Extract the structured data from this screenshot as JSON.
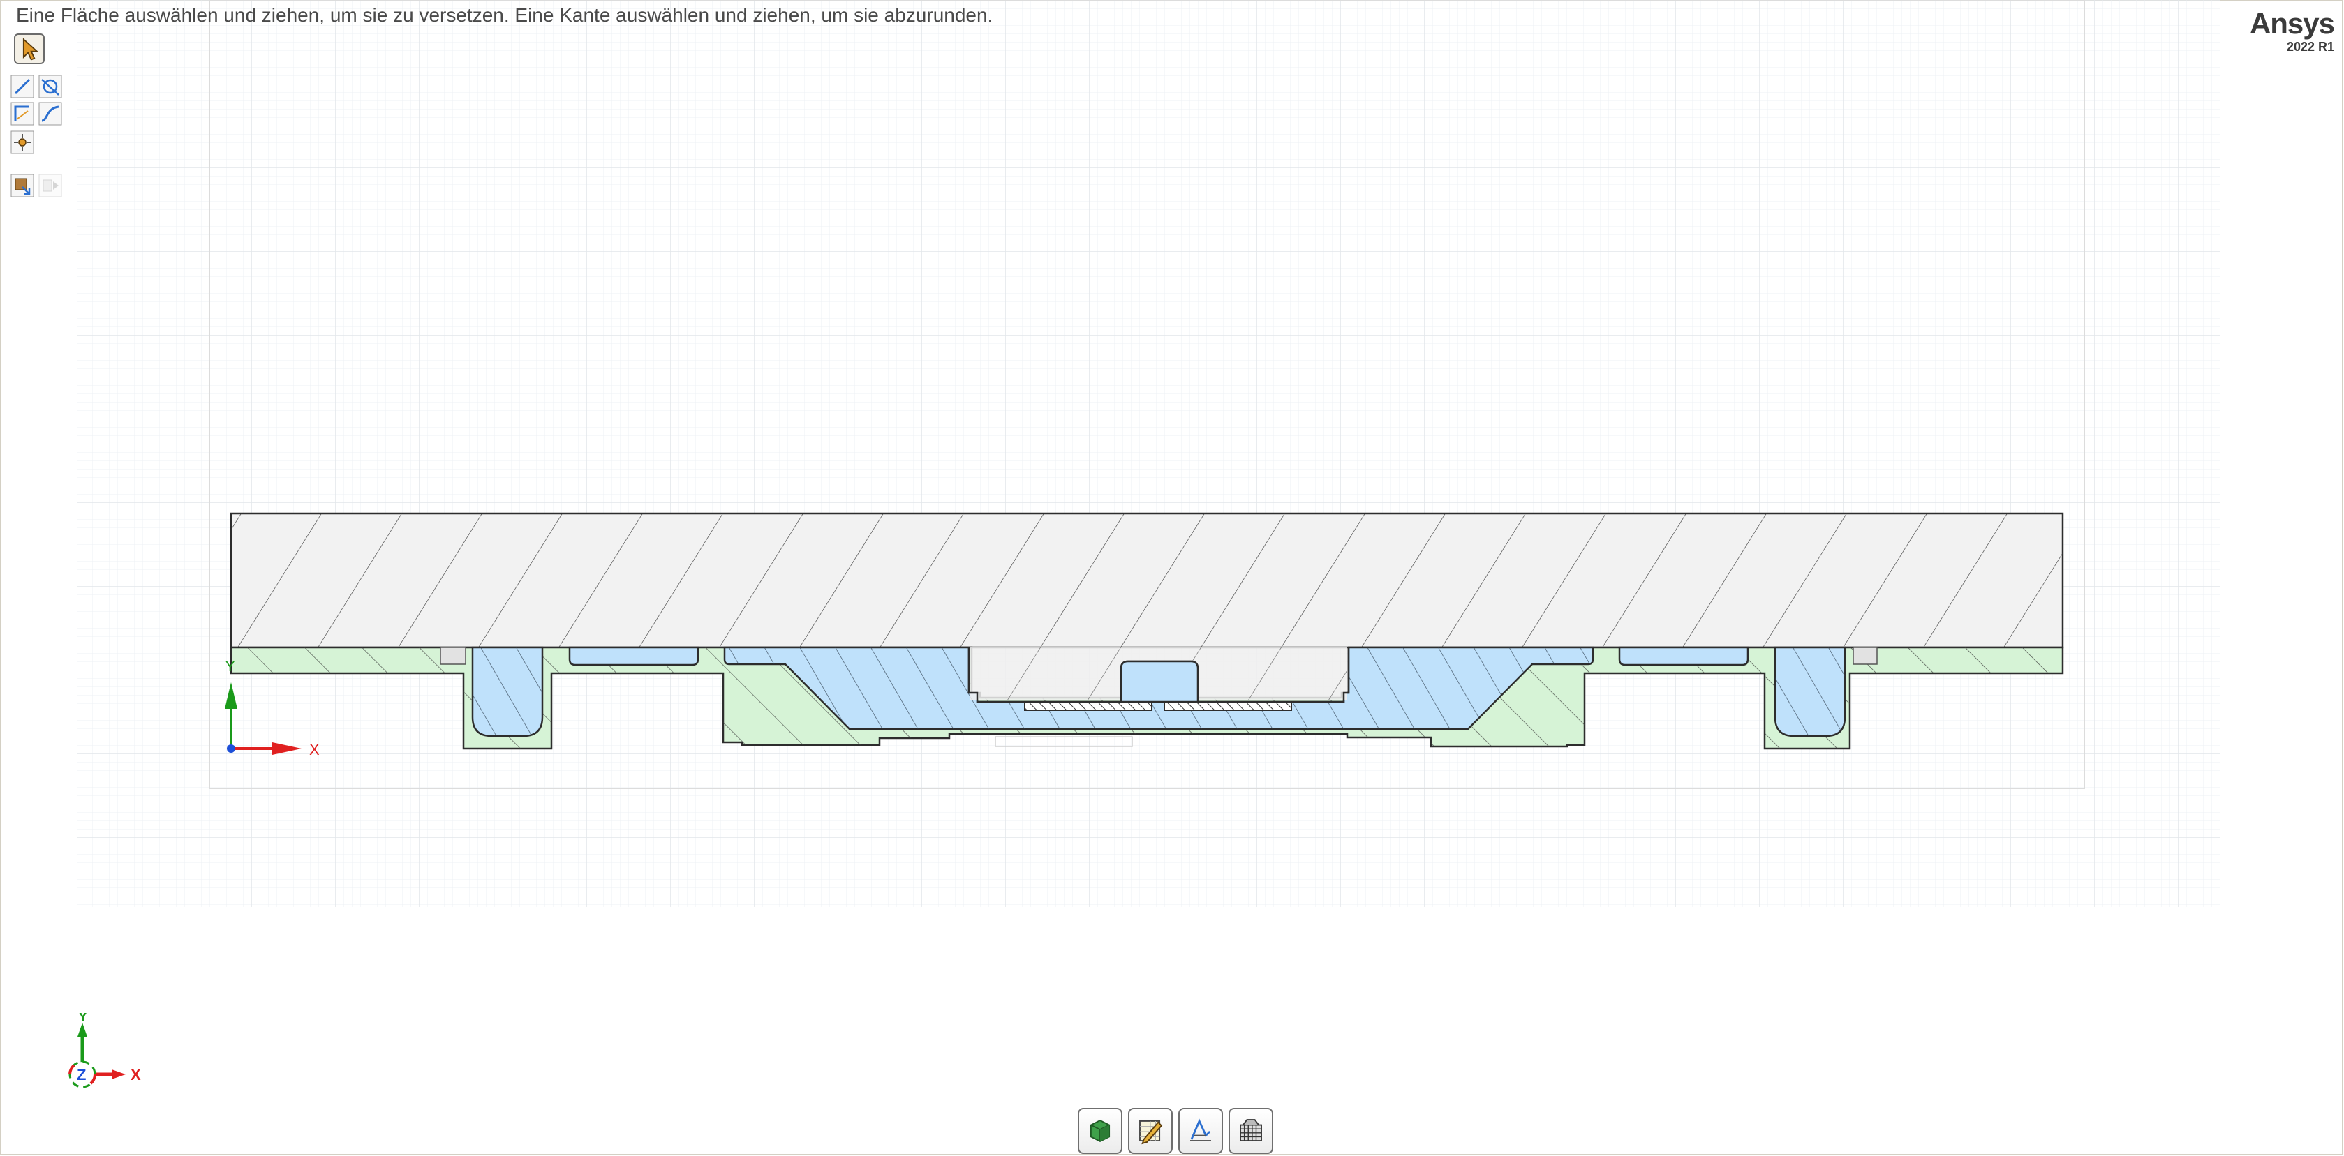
{
  "status": {
    "hint": "Eine Fläche auswählen und ziehen, um sie zu versetzen. Eine Kante auswählen und ziehen, um sie abzurunden."
  },
  "brand": {
    "name": "Ansys",
    "version": "2022 R1"
  },
  "tools": [
    {
      "name": "select-tool",
      "icon": "pointer-arrow-icon",
      "active": true
    },
    {
      "name": "line-tool",
      "icon": "line-icon"
    },
    {
      "name": "trim-tool",
      "icon": "trim-icon"
    },
    {
      "name": "corner-tool",
      "icon": "corner-icon"
    },
    {
      "name": "spline-tool",
      "icon": "spline-icon"
    },
    {
      "name": "point-tool",
      "icon": "point-icon"
    },
    {
      "name": "return-3d-tool",
      "icon": "return-3d-icon"
    },
    {
      "name": "next-tool",
      "icon": "next-icon",
      "disabled": true
    }
  ],
  "sketch_axes": {
    "y_label": "Y",
    "x_label": "X"
  },
  "view_triad": {
    "y_label": "Y",
    "x_label": "X",
    "z_label": "Z"
  },
  "bottom_toolbar": [
    {
      "name": "solid-mode-button",
      "icon": "cube-icon"
    },
    {
      "name": "sketch-mode-button",
      "icon": "sketch-pencil-icon"
    },
    {
      "name": "section-mode-button",
      "icon": "section-icon"
    },
    {
      "name": "layout-mode-button",
      "icon": "grid-plane-icon"
    }
  ],
  "colors": {
    "plate_fill": "#f0f0f0",
    "green_region": "#d8f5d8",
    "blue_region": "#bfe1fb",
    "outline": "#2d2d2d",
    "axis_x": "#e02020",
    "axis_y": "#1a9a1a",
    "axis_z": "#1d4fd8",
    "grid": "#e4e8ec"
  }
}
